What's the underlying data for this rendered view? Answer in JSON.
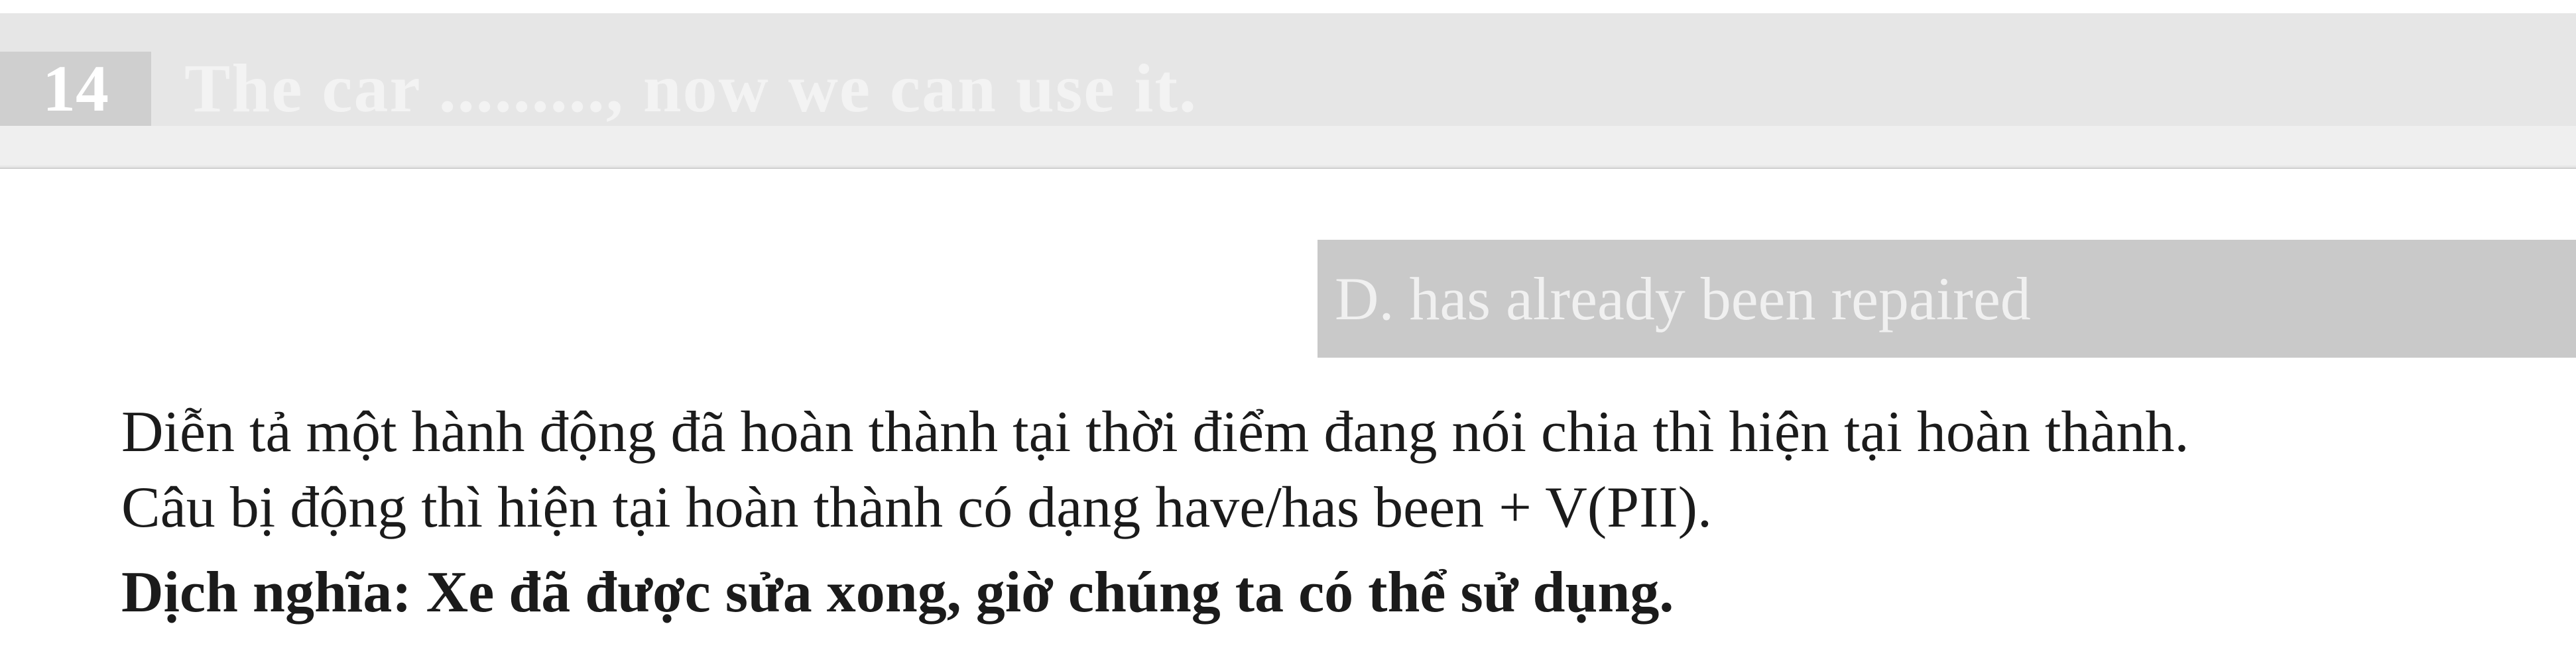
{
  "question": {
    "number": "14",
    "text": "The car ........., now we can use it."
  },
  "answer": {
    "text": "D. has already been repaired"
  },
  "explanation": {
    "line1": "Diễn tả một hành động đã hoàn thành tại thời điểm đang nói chia thì hiện tại hoàn thành.",
    "line2": "Câu bị động thì hiện tại hoàn thành có dạng have/has been + V(PII)."
  },
  "translation": {
    "text": "Dịch nghĩa: Xe đã được sửa xong, giờ chúng ta có thể sử dụng."
  },
  "colors": {
    "question_band": "#e6e6e6",
    "answer_box": "#c9c9c9",
    "text": "#1b1b1b"
  }
}
